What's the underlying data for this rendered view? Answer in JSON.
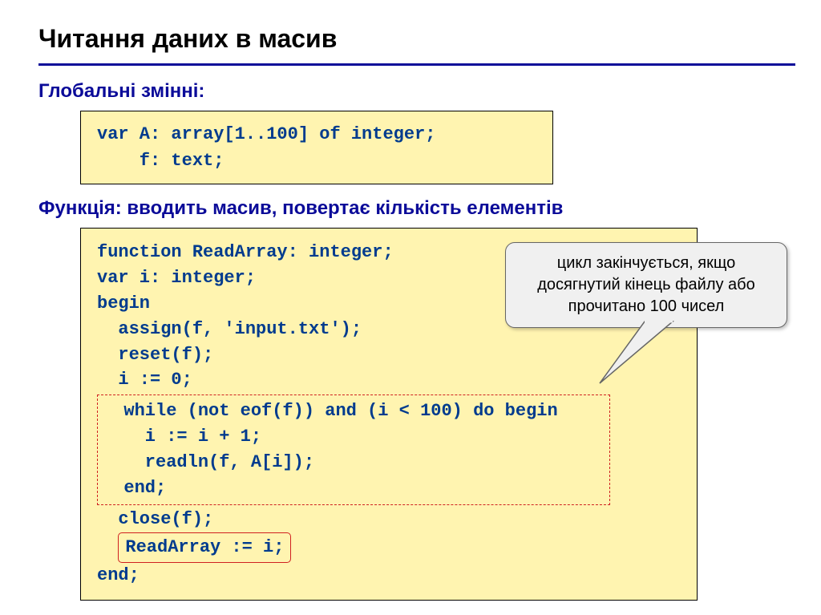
{
  "title": "Читання даних в масив",
  "section1": "Глобальні змінні:",
  "code1": "var A: array[1..100] of integer;\n    f: text;",
  "section2": "Функція: вводить масив, повертає кількість елементів",
  "code2": {
    "head": "function ReadArray: integer;\nvar i: integer;\nbegin\n  assign(f, 'input.txt');\n  reset(f);\n  i := 0;",
    "while_block": "  while (not eof(f)) and (i < 100) do begin\n    i := i + 1;\n    readln(f, A[i]);\n  end;",
    "after_while": "  close(f);",
    "readarray_line": "ReadArray := i;",
    "tail": "end;"
  },
  "callout": "цикл закінчується, якщо досягнутий кінець файлу або прочитано 100 чисел"
}
